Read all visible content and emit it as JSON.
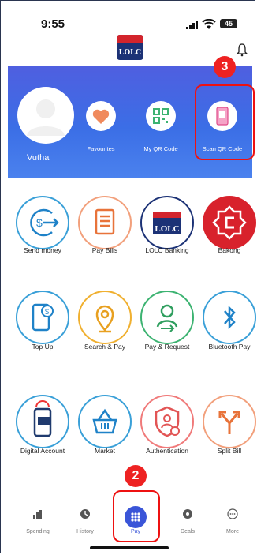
{
  "status": {
    "time": "9:55",
    "battery": "45"
  },
  "header": {
    "logo_text": "LOLC",
    "brand_red": "#d3242c",
    "brand_navy": "#1c3276"
  },
  "profile": {
    "name": "Vutha"
  },
  "quick_actions": [
    {
      "label": "Favourites",
      "icon": "heart-icon"
    },
    {
      "label": "My QR Code",
      "icon": "qr-code-icon"
    },
    {
      "label": "Scan QR Code",
      "icon": "scan-qr-icon"
    }
  ],
  "services": [
    {
      "label": "Send money",
      "icon": "send-money-icon"
    },
    {
      "label": "Pay Bills",
      "icon": "bill-icon"
    },
    {
      "label": "LOLC Banking",
      "icon": "lolc-logo-icon"
    },
    {
      "label": "Bakong",
      "icon": "bakong-icon"
    },
    {
      "label": "Top Up",
      "icon": "top-up-icon"
    },
    {
      "label": "Search & Pay",
      "icon": "location-pin-icon"
    },
    {
      "label": "Pay & Request",
      "icon": "user-transfer-icon"
    },
    {
      "label": "Bluetooth Pay",
      "icon": "bluetooth-icon"
    },
    {
      "label": "Digital Account",
      "icon": "digital-account-icon"
    },
    {
      "label": "Market",
      "icon": "basket-icon"
    },
    {
      "label": "Authentication",
      "icon": "shield-user-icon"
    },
    {
      "label": "Split Bill",
      "icon": "split-arrow-icon"
    }
  ],
  "nav": [
    {
      "label": "Spending",
      "icon": "bar-chart-icon"
    },
    {
      "label": "History",
      "icon": "history-icon"
    },
    {
      "label": "Pay",
      "icon": "grid-icon"
    },
    {
      "label": "Deals",
      "icon": "deals-icon"
    },
    {
      "label": "More",
      "icon": "more-icon"
    }
  ],
  "annotations": {
    "step_pay": "2",
    "step_scan": "3"
  },
  "colors": {
    "banner": "#4b6fe6",
    "accent_blue": "#3aa0d8",
    "annotation_red": "#ee2222"
  }
}
